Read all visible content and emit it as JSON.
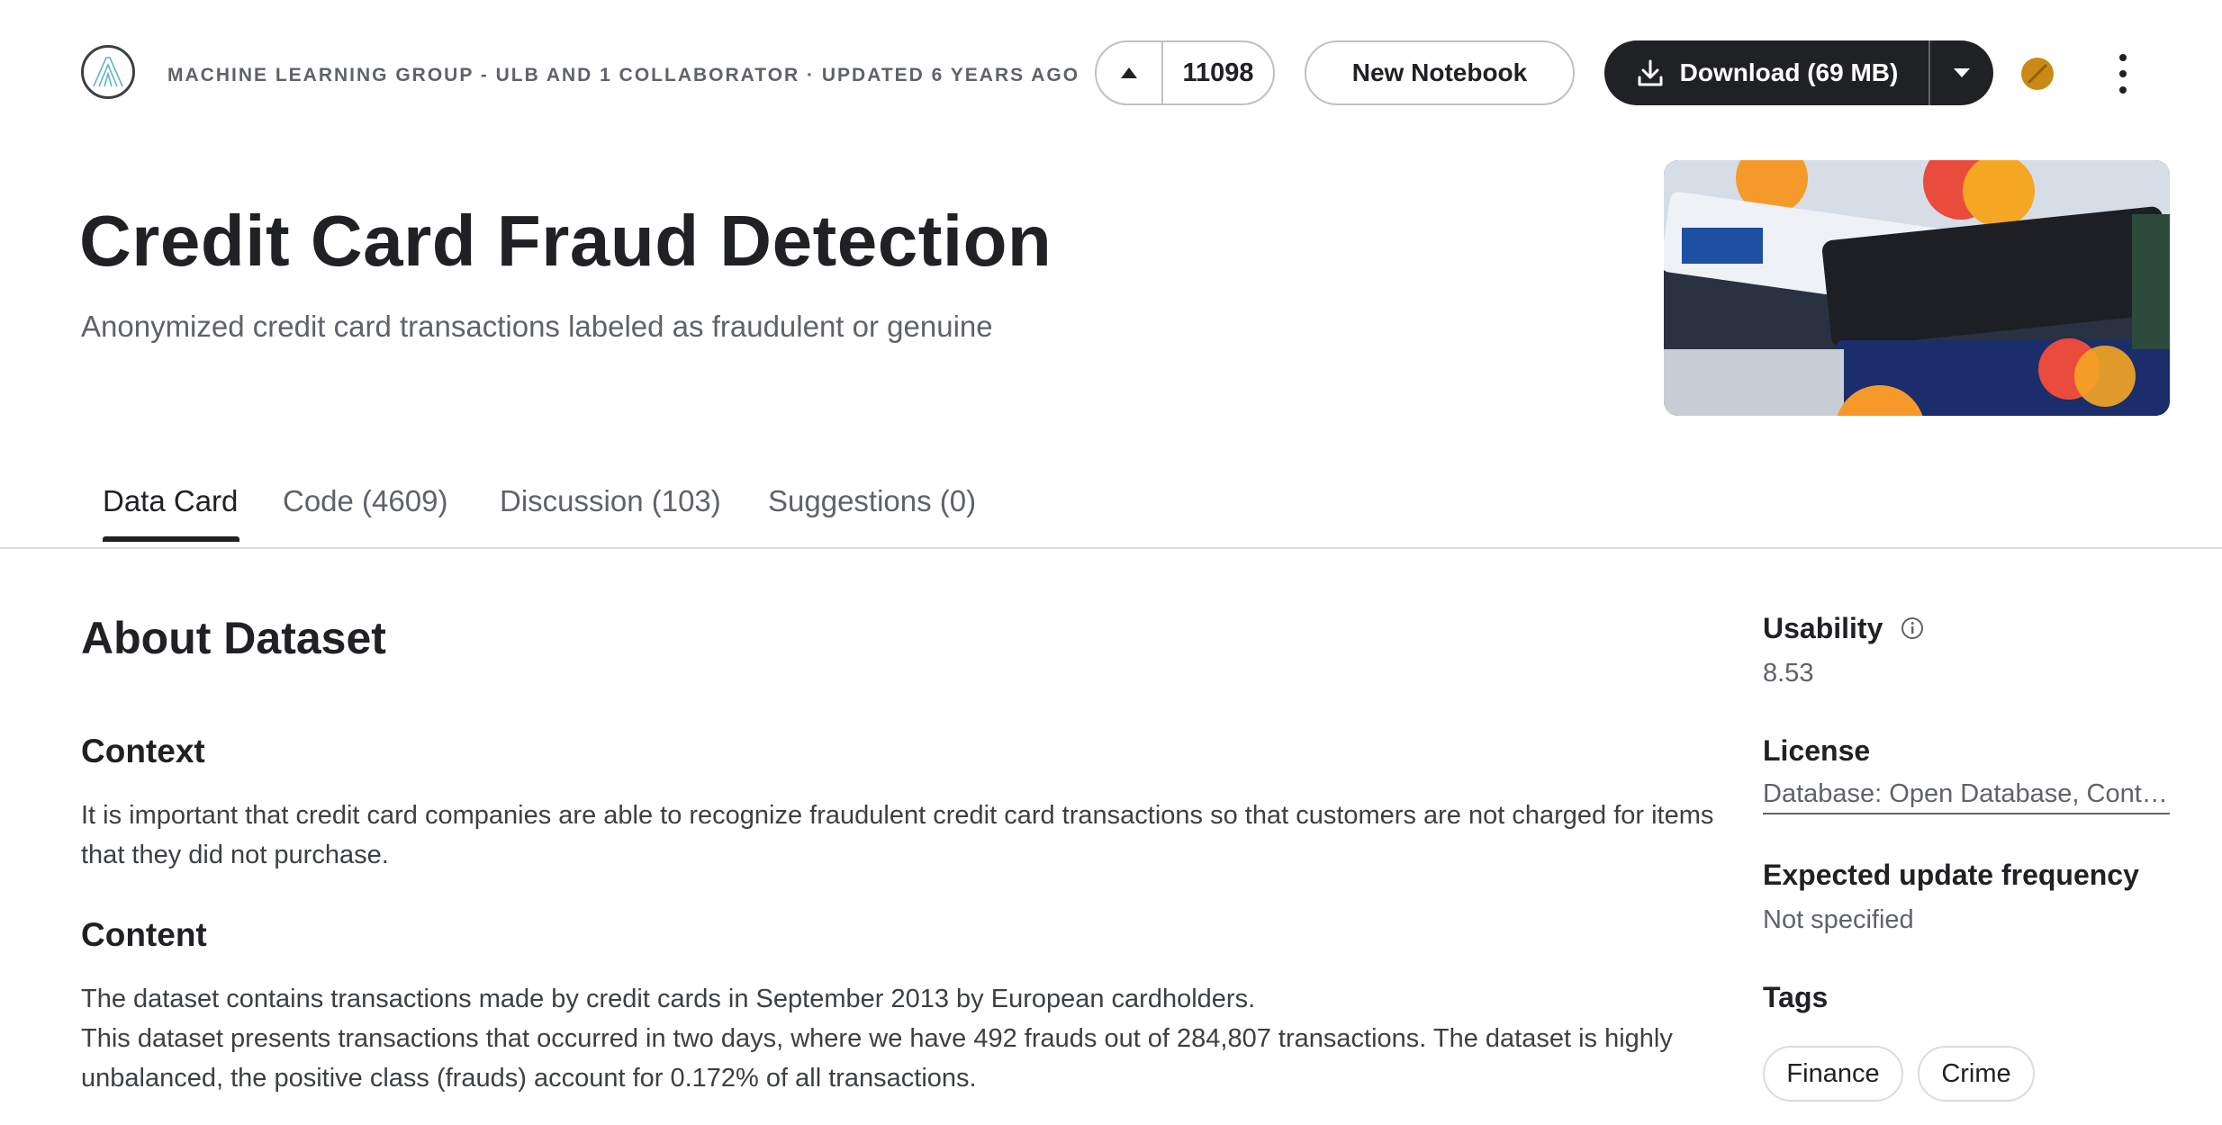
{
  "header": {
    "meta": "MACHINE LEARNING GROUP - ULB AND 1 COLLABORATOR · UPDATED 6 YEARS AGO",
    "vote_count": "11098",
    "new_notebook_label": "New Notebook",
    "download_label": "Download (69 MB)"
  },
  "hero": {
    "title": "Credit Card Fraud Detection",
    "subtitle": "Anonymized credit card transactions labeled as fraudulent or genuine"
  },
  "tabs": [
    {
      "label": "Data Card",
      "active": true
    },
    {
      "label": "Code (4609)",
      "active": false
    },
    {
      "label": "Discussion (103)",
      "active": false
    },
    {
      "label": "Suggestions (0)",
      "active": false
    }
  ],
  "main": {
    "about_heading": "About Dataset",
    "context_heading": "Context",
    "context_text": "It is important that credit card companies are able to recognize fraudulent credit card transactions so that customers are not charged for items that they did not purchase.",
    "content_heading": "Content",
    "content_line1": "The dataset contains transactions made by credit cards in September 2013 by European cardholders.",
    "content_line2": "This dataset presents transactions that occurred in two days, where we have 492 frauds out of 284,807 transactions. The dataset is highly unbalanced, the positive class (frauds) account for 0.172% of all transactions."
  },
  "sidebar": {
    "usability_label": "Usability",
    "usability_value": "8.53",
    "license_label": "License",
    "license_value": "Database: Open Database, Contents: Database Contents",
    "frequency_label": "Expected update frequency",
    "frequency_value": "Not specified",
    "tags_label": "Tags",
    "tags": [
      "Finance",
      "Crime"
    ]
  },
  "colors": {
    "primary_dark": "#202124",
    "muted_text": "#5f6368",
    "border": "#dadce0",
    "tier_badge": "#c98a16"
  },
  "icons": [
    "logo-icon",
    "upvote-arrow-icon",
    "download-icon",
    "caret-down-icon",
    "more-vertical-icon",
    "info-icon"
  ]
}
